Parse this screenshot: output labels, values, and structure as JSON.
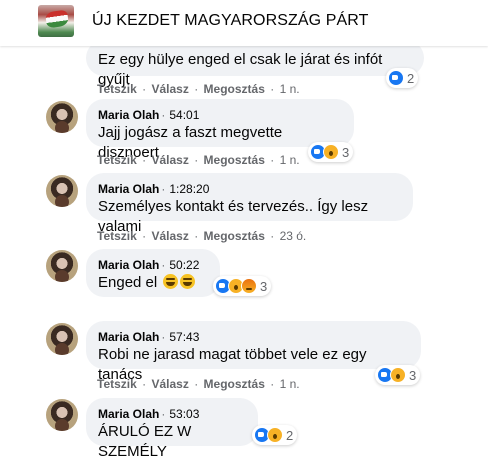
{
  "header": {
    "title": "ÚJ KEZDET MAGYARORSZÁG PÁRT"
  },
  "actions": {
    "like": "Tetszik",
    "reply": "Válasz",
    "share": "Megosztás",
    "sep": "·"
  },
  "comments": [
    {
      "author": "",
      "time": "",
      "text": "Ez egy hülye enged el csak le járat és infót gyűjt",
      "age": "1 n.",
      "reactions": [
        "like"
      ],
      "count": "2"
    },
    {
      "author": "Maria Olah",
      "time": "54:01",
      "text": "Jajj jogász a faszt megvette disznoert",
      "age": "1 n.",
      "reactions": [
        "like",
        "wow"
      ],
      "count": "3"
    },
    {
      "author": "Maria Olah",
      "time": "1:28:20",
      "text": "Személyes kontakt és tervezés.. Így lesz valami",
      "age": "23 ó.",
      "reactions": [],
      "count": ""
    },
    {
      "author": "Maria Olah",
      "time": "50:22",
      "text": "Enged el",
      "age": "",
      "reactions": [
        "like",
        "wow",
        "angry"
      ],
      "count": "3"
    },
    {
      "author": "Maria Olah",
      "time": "57:43",
      "text": "Robi ne jarasd magat többet vele ez egy tanács",
      "age": "1 n.",
      "reactions": [
        "like",
        "wow"
      ],
      "count": "3"
    },
    {
      "author": "Maria Olah",
      "time": "53:03",
      "text": "ÁRULÓ EZ W SZEMÉLY",
      "age": "",
      "reactions": [
        "like",
        "wow"
      ],
      "count": "2"
    }
  ],
  "icons": {
    "page_logo": "hungary-flag-map-logo",
    "avatar": "user-avatar",
    "like": "like-reaction-icon",
    "wow": "wow-reaction-icon",
    "angry": "angry-reaction-icon",
    "haha": "laughing-emoji-icon"
  },
  "colors": {
    "bubble": "#f0f2f5",
    "like_blue": "#1877f2",
    "meta_gray": "#65676b"
  }
}
